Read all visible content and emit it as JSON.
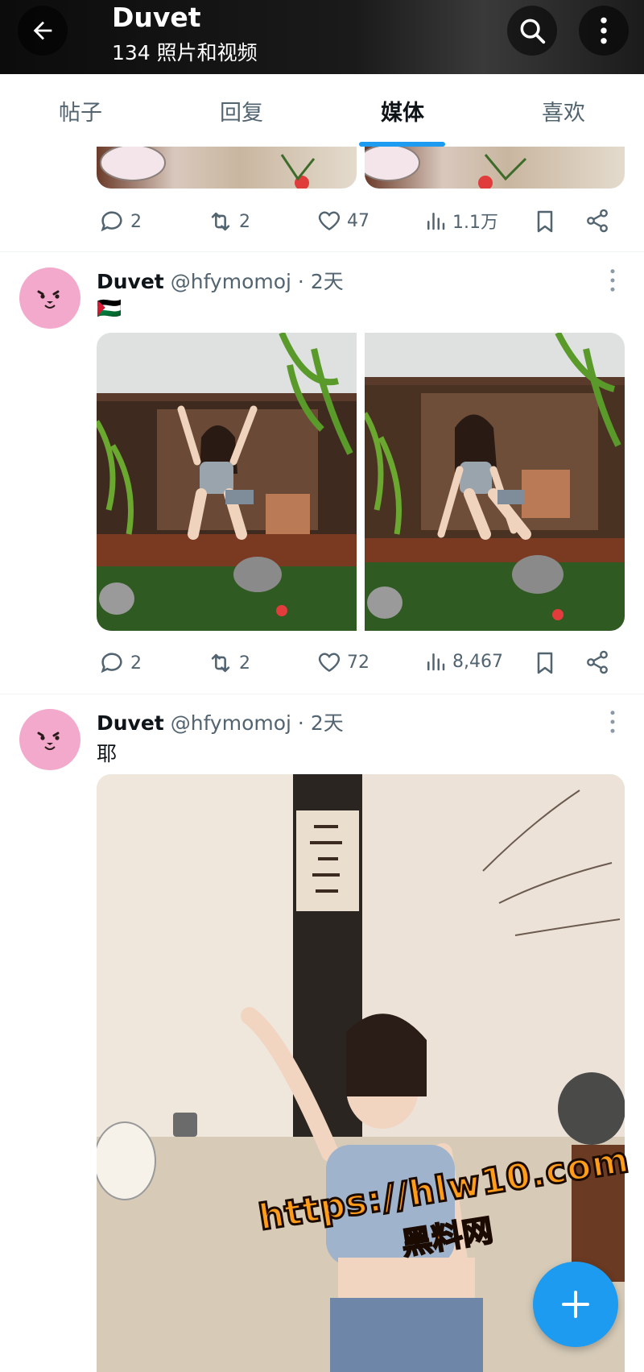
{
  "header": {
    "title": "Duvet",
    "subtitle": "134 照片和视频"
  },
  "tabs": [
    {
      "label": "帖子"
    },
    {
      "label": "回复"
    },
    {
      "label": "媒体",
      "active": true
    },
    {
      "label": "喜欢"
    }
  ],
  "posts": [
    {
      "partial": true,
      "actions": {
        "replies": "2",
        "reposts": "2",
        "likes": "47",
        "views": "1.1万"
      }
    },
    {
      "name": "Duvet",
      "handle": "@hfymomoj",
      "time": "· 2天",
      "text": "🇵🇸",
      "actions": {
        "replies": "2",
        "reposts": "2",
        "likes": "72",
        "views": "8,467"
      }
    },
    {
      "name": "Duvet",
      "handle": "@hfymomoj",
      "time": "· 2天",
      "text": "耶"
    }
  ],
  "watermark": {
    "url": "https://hlw10.com",
    "site": "黑料网"
  },
  "colors": {
    "accent": "#1d9bf0",
    "avatar": "#f2a9cc",
    "muted": "#536471"
  }
}
